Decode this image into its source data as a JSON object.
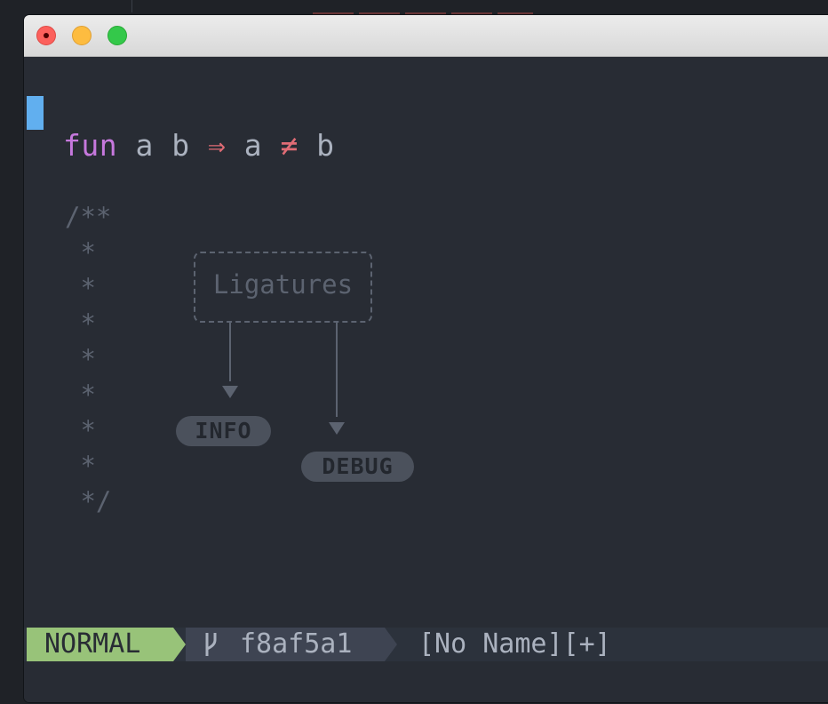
{
  "editor": {
    "code_line": {
      "keyword": "fun",
      "text1": " a b ",
      "op1": "⇒",
      "text2": " a ",
      "op2": "≠",
      "text3": " b"
    },
    "comment_lines": [
      "/**",
      " *",
      " *",
      " *",
      " *",
      " *",
      " *",
      " *",
      " */"
    ],
    "diagram": {
      "box_label": "Ligatures",
      "badge_info": "INFO",
      "badge_debug": "DEBUG"
    }
  },
  "statusline": {
    "mode": "NORMAL",
    "branch": "f8af5a1",
    "branch_icon": "git-branch-icon",
    "filename": "[No Name][+]"
  },
  "colors": {
    "background": "#282c34",
    "cursor": "#61afef",
    "keyword": "#c678dd",
    "operator": "#e06c75",
    "comment": "#5c6370",
    "mode_bg": "#98c379"
  }
}
